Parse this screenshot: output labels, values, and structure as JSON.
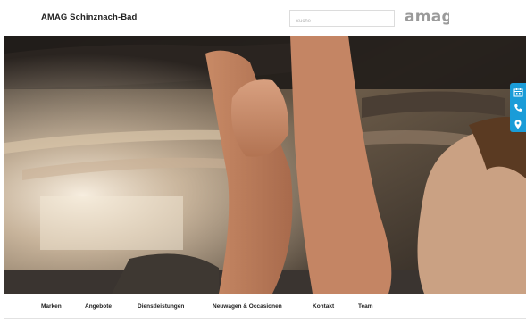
{
  "header": {
    "site_title": "AMAG Schinznach-Bad",
    "search_placeholder": "Suche",
    "logo_text": "amag",
    "logo_color": "#9a9a9a"
  },
  "hero": {
    "description_icon": "mechanic-photo",
    "accent": "#1a9cd8"
  },
  "side_tools": [
    {
      "icon": "calendar-icon"
    },
    {
      "icon": "phone-icon"
    },
    {
      "icon": "map-pin-icon"
    }
  ],
  "nav": {
    "items": [
      {
        "label": "Marken"
      },
      {
        "label": "Angebote"
      },
      {
        "label": "Dienstleistungen"
      },
      {
        "label": "Neuwagen & Occasionen"
      },
      {
        "label": "Kontakt"
      },
      {
        "label": "Team"
      }
    ]
  }
}
